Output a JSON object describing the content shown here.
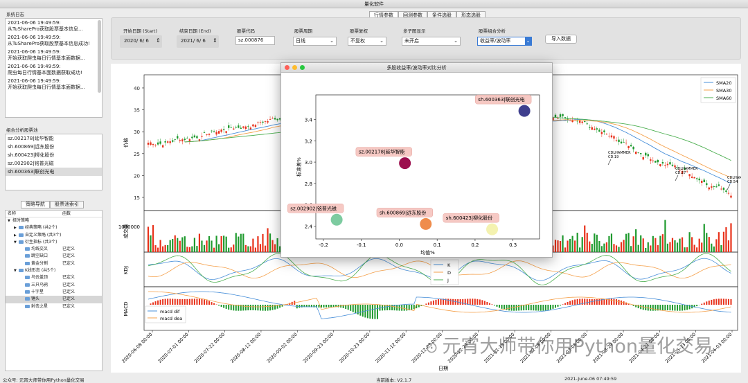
{
  "app": {
    "title": "量化软件"
  },
  "log": {
    "label": "系统日志",
    "entries": [
      {
        "time": "2021-06-06 19:49:59:",
        "msg": "从TuSharePro获取股票基本信息..."
      },
      {
        "time": "2021-06-06 19:49:59:",
        "msg": "从TuSharePro获取股票基本信息成功!"
      },
      {
        "time": "2021-06-06 19:49:59:",
        "msg": "开始获取爬虫每日行情基本面数据..."
      },
      {
        "time": "2021-06-06 19:49:59:",
        "msg": "爬虫每日行情基本面数据获取成功!"
      },
      {
        "time": "2021-06-06 19:49:59:",
        "msg": "开始获取爬虫每日行情基本面数据..."
      }
    ]
  },
  "pool": {
    "label": "组合分析股票池",
    "items": [
      "sz.002178|延华智能",
      "sh.600869|远东股份",
      "sh.600423|柳化股份",
      "sz.002902|铭普光磁",
      "sh.600363|联创光电"
    ]
  },
  "nav": {
    "tab_strategy": "策略导航",
    "tab_index": "股票池索引",
    "col_name": "名称",
    "col_func": "函数"
  },
  "tree": [
    {
      "label": "择时策略",
      "func": "",
      "level": 0,
      "arrow": "▼",
      "folder": false
    },
    {
      "label": "经典策略 (共2个)",
      "func": "",
      "level": 1,
      "arrow": "▶",
      "folder": true
    },
    {
      "label": "自定义策略 (共3个)",
      "func": "",
      "level": 1,
      "arrow": "▶",
      "folder": true
    },
    {
      "label": "衍生指标 (共3个)",
      "func": "",
      "level": 1,
      "arrow": "▼",
      "folder": true
    },
    {
      "label": "均线交叉",
      "func": "已定义",
      "level": 2,
      "arrow": "",
      "folder": true
    },
    {
      "label": "跳空缺口",
      "func": "已定义",
      "level": 2,
      "arrow": "",
      "folder": true
    },
    {
      "label": "黄金分割",
      "func": "已定义",
      "level": 2,
      "arrow": "",
      "folder": true
    },
    {
      "label": "K线形态 (共5个)",
      "func": "",
      "level": 1,
      "arrow": "▼",
      "folder": true
    },
    {
      "label": "乌云盖顶",
      "func": "已定义",
      "level": 2,
      "arrow": "",
      "folder": true
    },
    {
      "label": "三只乌鸦",
      "func": "已定义",
      "level": 2,
      "arrow": "",
      "folder": true
    },
    {
      "label": "十字星",
      "func": "已定义",
      "level": 2,
      "arrow": "",
      "folder": true
    },
    {
      "label": "锤头",
      "func": "已定义",
      "level": 2,
      "arrow": "",
      "folder": true,
      "selected": true
    },
    {
      "label": "射击之星",
      "func": "已定义",
      "level": 2,
      "arrow": "",
      "folder": true
    }
  ],
  "top_tabs": [
    "行情参数",
    "回测参数",
    "条件选股",
    "形态选股"
  ],
  "params": {
    "start_label": "开始日期 (Start)",
    "start_value": "2020/ 6/ 6",
    "end_label": "结束日期 (End)",
    "end_value": "2021/ 6/ 6",
    "code_label": "股票代码",
    "code_value": "sz.000876",
    "period_label": "股票周期",
    "period_value": "日线",
    "adjust_label": "股票复权",
    "adjust_value": "不复权",
    "subplot_label": "多子图显示",
    "subplot_value": "未开启",
    "portfolio_label": "股票组合分析",
    "portfolio_value": "收益率/波动率",
    "import_button": "导入数据"
  },
  "main_chart": {
    "price_ylabel": "价格",
    "price_ticks": [
      "40",
      "35",
      "30",
      "25",
      "20",
      "15"
    ],
    "volume_ylabel": "成交量",
    "volume_tick": "1000000",
    "kdj_ylabel": "KDJ",
    "macd_ylabel": "MACD",
    "xlabel": "日期",
    "x_ticks": [
      "2020-06-08 00:00",
      "2020-07-01 00:00",
      "2020-07-22 00:00",
      "2020-08-12 00:00",
      "2020-09-02 00:00",
      "2020-09-23 00:00",
      "2020-10-23 00:00",
      "2020-11-12 00:00",
      "2020-12-03 00:00",
      "2020-12-24 00:00",
      "2021-01-18 00:00",
      "2021-02-08 00:00",
      "2021-03-08 00:00",
      "2021-03-29 00:00",
      "2021-04-21 00:00",
      "2021-05-13 00:00",
      "2021-06-03 00:00"
    ],
    "sma_legend": [
      "SMA20",
      "SMA30",
      "SMA60"
    ],
    "kdj_legend": [
      "K",
      "D",
      "J"
    ],
    "macd_legend": [
      "macd dif",
      "macd dea"
    ],
    "annotations": [
      {
        "text": "CDLHAMMER",
        "sub": "CD.19"
      },
      {
        "text": "CDLHAMMER",
        "sub": "CD.27"
      },
      {
        "text": "CDLHAMMER",
        "sub": "CD.54"
      }
    ]
  },
  "popup": {
    "title": "多股收益率/波动率对比分析",
    "xlabel": "均值%",
    "ylabel": "标准差%"
  },
  "chart_data": {
    "type": "scatter",
    "title": "",
    "xlabel": "均值%",
    "ylabel": "标准差%",
    "xlim": [
      -0.22,
      0.37
    ],
    "ylim": [
      2.28,
      3.63
    ],
    "x_ticks": [
      "-0.2",
      "-0.1",
      "0.0",
      "0.1",
      "0.2",
      "0.3"
    ],
    "y_ticks": [
      "2.4",
      "2.6",
      "2.8",
      "3.0",
      "3.2",
      "3.4"
    ],
    "points": [
      {
        "label": "sh.600363|联创光电",
        "x": 0.33,
        "y": 3.48,
        "color": "#3f3f8e"
      },
      {
        "label": "sz.002178|延华智能",
        "x": 0.015,
        "y": 2.99,
        "color": "#9c0f4e"
      },
      {
        "label": "sz.002902|铭普光磁",
        "x": -0.165,
        "y": 2.46,
        "color": "#7dcba0"
      },
      {
        "label": "sh.600869|远东股份",
        "x": 0.07,
        "y": 2.42,
        "color": "#ef8c4c"
      },
      {
        "label": "sh.600423|柳化股份",
        "x": 0.245,
        "y": 2.37,
        "color": "#f4f2b0"
      }
    ]
  },
  "status": {
    "left": "公众号: 元宵大师带你用Python量化交易",
    "version": "当前版本: V2.1.7",
    "time": "2021-June-06 07:49:59"
  },
  "watermark": "元宵大师带你用Python量化交易",
  "colors": {
    "up": "#e8311a",
    "down": "#1f9a2e",
    "sma20": "#4a90d9",
    "sma30": "#f5a04a",
    "sma60": "#4caf50"
  }
}
